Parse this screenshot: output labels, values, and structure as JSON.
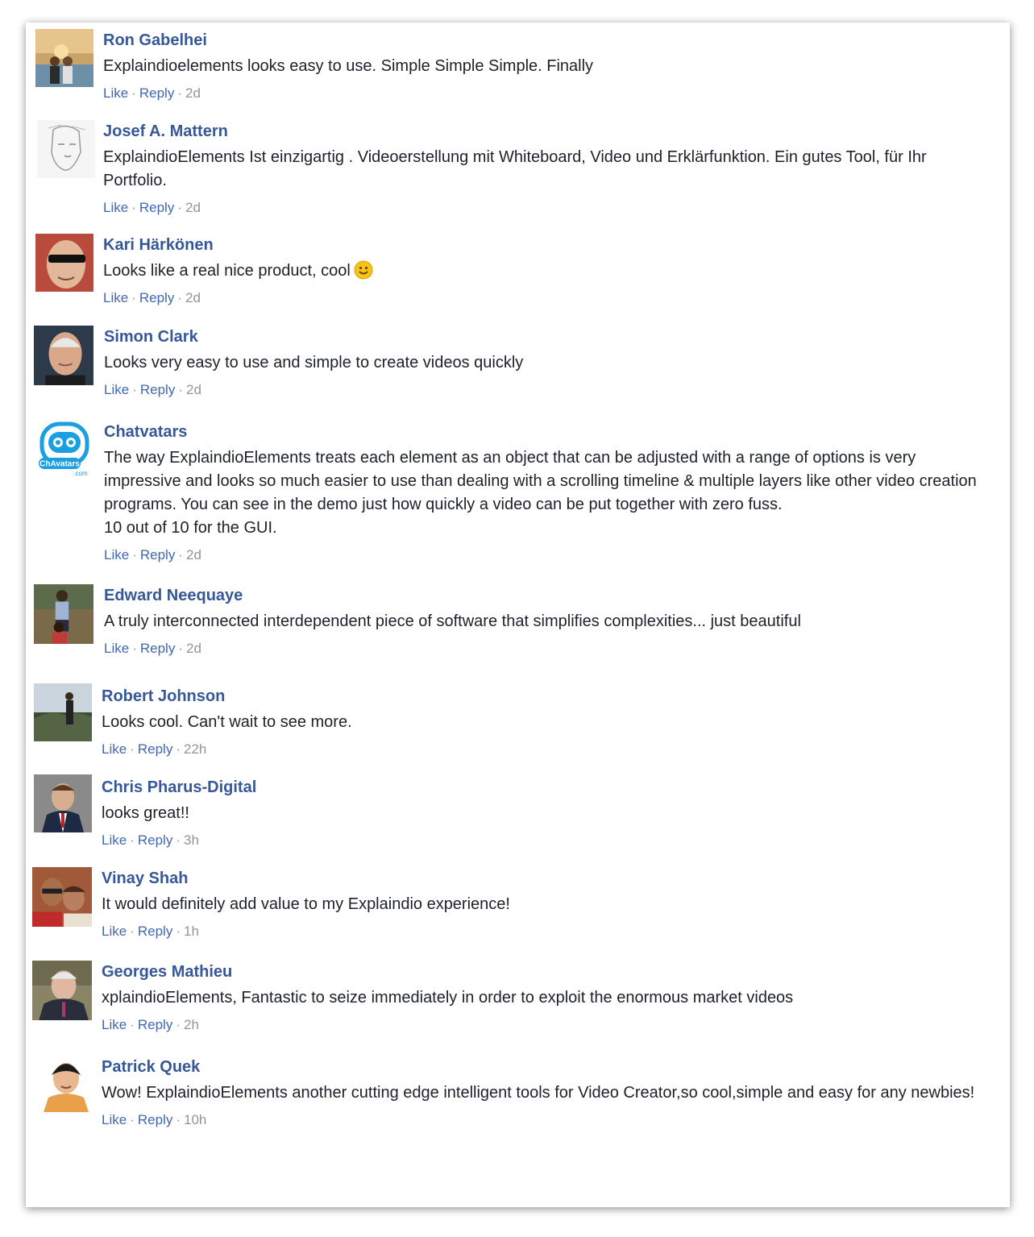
{
  "actions": {
    "like": "Like",
    "reply": "Reply",
    "separator": "·"
  },
  "comments": [
    {
      "author": "Ron Gabelhei",
      "text": "Explaindioelements looks easy to use. Simple Simple Simple. Finally",
      "time": "2d",
      "avatar_icon": "user-photo"
    },
    {
      "author": "Josef A. Mattern",
      "text": "ExplaindioElements Ist einzigartig . Videoerstellung mit Whiteboard, Video und Erklärfunktion. Ein gutes Tool, für Ihr Portfolio.",
      "time": "2d",
      "avatar_icon": "user-photo"
    },
    {
      "author": "Kari Härkönen",
      "text": "Looks like a real nice product, cool",
      "time": "2d",
      "avatar_icon": "user-photo",
      "emoji": "smiley-emoji"
    },
    {
      "author": "Simon Clark",
      "text": "Looks very easy to use and simple to create videos quickly",
      "time": "2d",
      "avatar_icon": "user-photo"
    },
    {
      "author": "Chatvatars",
      "text": "The way ExplaindioElements treats each element as an object that can be adjusted with a range of options is very impressive and looks so much easier to use than dealing with a scrolling timeline & multiple layers like other video creation programs. You can see in the demo just how quickly a video can be put together with zero fuss.\n10 out of 10 for the GUI.",
      "time": "2d",
      "avatar_icon": "chatvatars-logo",
      "avatar_text": "ChAvatars",
      "avatar_subtext": ".com"
    },
    {
      "author": "Edward Neequaye",
      "text": "A truly interconnected interdependent piece of software that simplifies complexities... just beautiful",
      "time": "2d",
      "avatar_icon": "user-photo"
    },
    {
      "author": "Robert Johnson",
      "text": "Looks cool. Can't wait to see more.",
      "time": "22h",
      "avatar_icon": "user-photo"
    },
    {
      "author": "Chris Pharus-Digital",
      "text": "looks great!!",
      "time": "3h",
      "avatar_icon": "user-photo"
    },
    {
      "author": "Vinay Shah",
      "text": "It would definitely add value to my Explaindio experience!",
      "time": "1h",
      "avatar_icon": "user-photo"
    },
    {
      "author": "Georges Mathieu",
      "text": "xplaindioElements, Fantastic to seize immediately in order to exploit the enormous market videos",
      "time": "2h",
      "avatar_icon": "user-photo"
    },
    {
      "author": "Patrick Quek",
      "text": "Wow! ExplaindioElements another cutting edge intelligent tools for Video Creator,so cool,simple and easy for any newbies!",
      "time": "10h",
      "avatar_icon": "user-photo"
    }
  ],
  "colors": {
    "author": "#365899",
    "link": "#4267b2",
    "meta": "#90949c",
    "text": "#1d2129"
  }
}
